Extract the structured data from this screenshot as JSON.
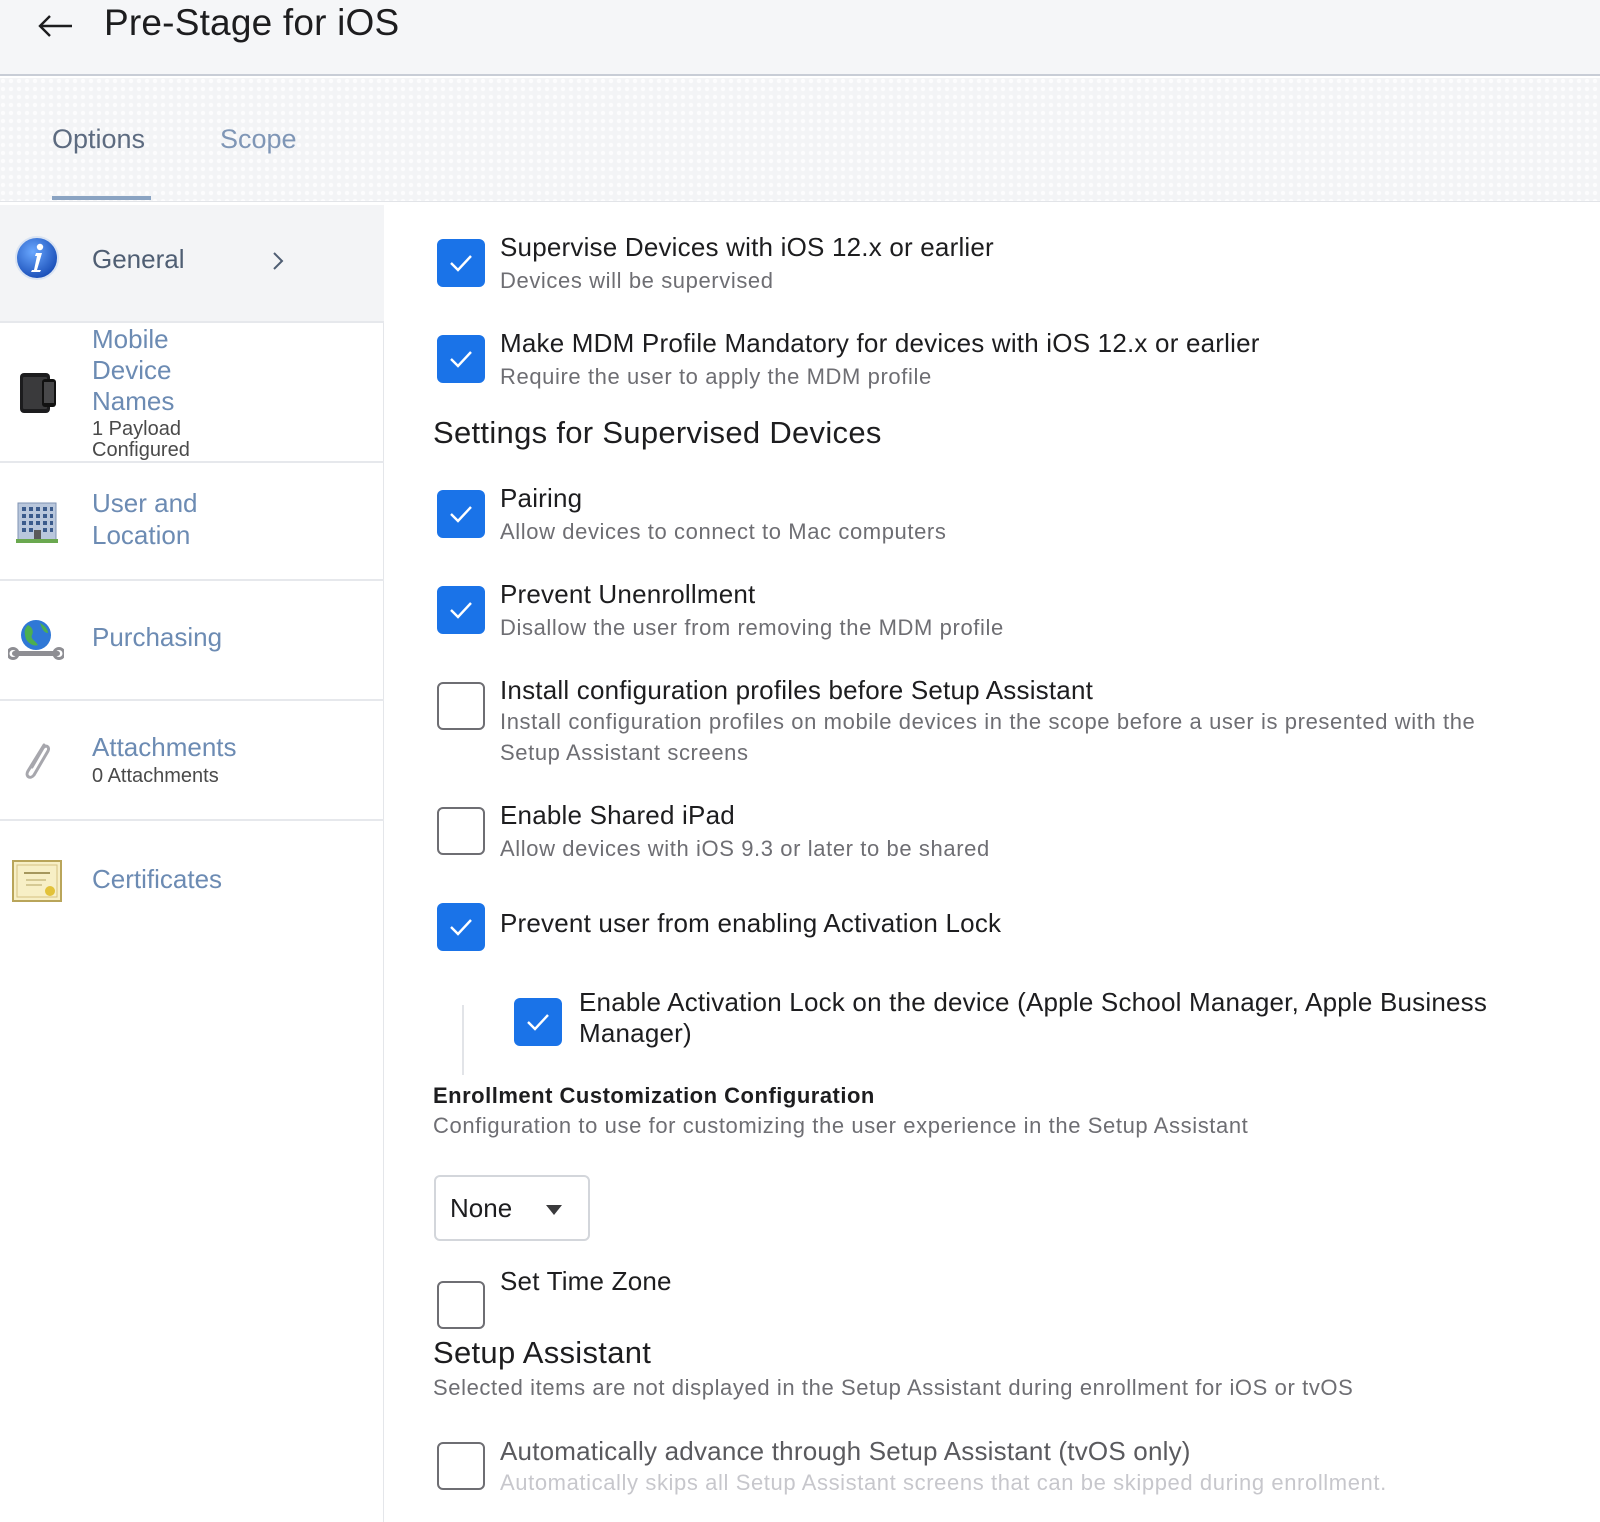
{
  "header": {
    "title": "Pre-Stage for iOS"
  },
  "tabs": [
    {
      "label": "Options",
      "active": true
    },
    {
      "label": "Scope",
      "active": false
    }
  ],
  "sidebar": {
    "items": [
      {
        "label": "General",
        "icon": "info-icon",
        "active": true
      },
      {
        "label_lines": [
          "Mobile",
          "Device",
          "Names"
        ],
        "sub_lines": [
          "1 Payload",
          "Configured"
        ],
        "icon": "mobile-devices-icon"
      },
      {
        "label_lines": [
          "User and",
          "Location"
        ],
        "icon": "building-icon"
      },
      {
        "label": "Purchasing",
        "icon": "globe-wrench-icon"
      },
      {
        "label": "Attachments",
        "sub": "0 Attachments",
        "icon": "paperclip-icon"
      },
      {
        "label": "Certificates",
        "icon": "certificate-icon"
      }
    ]
  },
  "options": {
    "supervise": {
      "title": "Supervise Devices with iOS 12.x or earlier",
      "desc": "Devices will be supervised",
      "checked": true
    },
    "mdm_mandatory": {
      "title": "Make MDM Profile Mandatory for devices with iOS 12.x or earlier",
      "desc": "Require the user to apply the MDM profile",
      "checked": true
    },
    "supervised_heading": "Settings for Supervised Devices",
    "pairing": {
      "title": "Pairing",
      "desc": "Allow devices to connect to Mac computers",
      "checked": true
    },
    "prevent_unenroll": {
      "title": "Prevent Unenrollment",
      "desc": "Disallow the user from removing the MDM profile",
      "checked": true
    },
    "install_profiles": {
      "title": "Install configuration profiles before Setup Assistant",
      "desc_lines": [
        "Install configuration profiles on mobile devices in the scope before a user is presented with the",
        "Setup Assistant screens"
      ],
      "checked": false
    },
    "shared_ipad": {
      "title": "Enable Shared iPad",
      "desc": "Allow devices with iOS 9.3 or later to be shared",
      "checked": false
    },
    "activation_lock": {
      "title": "Prevent user from enabling Activation Lock",
      "checked": true
    },
    "enable_activation_lock": {
      "title_lines": [
        "Enable Activation Lock on the device (Apple School Manager, Apple Business",
        "Manager)"
      ],
      "checked": true
    },
    "enrollment_customization": {
      "heading": "Enrollment Customization Configuration",
      "desc": "Configuration to use for customizing the user experience in the Setup Assistant",
      "selected": "None"
    },
    "time_zone": {
      "title": "Set Time Zone",
      "checked": false
    },
    "setup_assistant": {
      "heading": "Setup Assistant",
      "desc": "Selected items are not displayed in the Setup Assistant during enrollment for iOS or tvOS"
    },
    "auto_advance": {
      "title": "Automatically advance through Setup Assistant (tvOS only)",
      "desc": "Automatically skips all Setup Assistant screens that can be skipped during enrollment.",
      "checked": false
    }
  },
  "colors": {
    "accent": "#1a73e8",
    "sidebar_link": "#6c8bb3",
    "tab_active": "#5d6b80",
    "tab_inactive": "#7f96b6"
  }
}
